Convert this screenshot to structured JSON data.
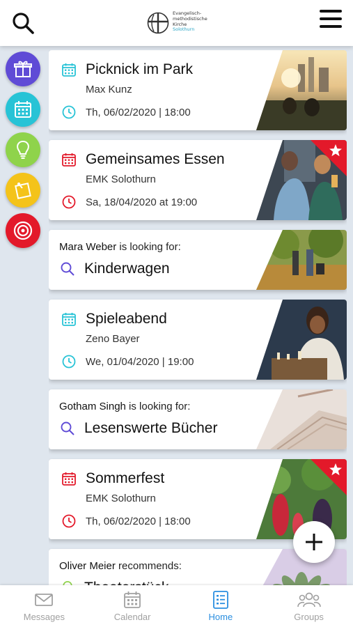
{
  "header": {
    "logo_lines": [
      "Evangelisch-",
      "methodistische",
      "Kirche"
    ],
    "logo_city": "Solothurn"
  },
  "rail": [
    {
      "name": "gift-icon",
      "color": "#5f4bd6"
    },
    {
      "name": "calendar-icon",
      "color": "#27c3d6"
    },
    {
      "name": "lightbulb-icon",
      "color": "#8fd34b"
    },
    {
      "name": "note-icon",
      "color": "#f4c31a"
    },
    {
      "name": "target-icon",
      "color": "#e3192a"
    }
  ],
  "feed": [
    {
      "type": "event",
      "title": "Picknick im Park",
      "subtitle": "Max Kunz",
      "date": "Th, 06/02/2020 | 18:00",
      "accent": "#27c3d6",
      "starred": false
    },
    {
      "type": "event",
      "title": "Gemeinsames Essen",
      "subtitle": "EMK Solothurn",
      "date": "Sa, 18/04/2020 at 19:00",
      "accent": "#e3192a",
      "starred": true
    },
    {
      "type": "looking",
      "person": "Mara Weber",
      "suffix": " is looking for:",
      "item": "Kinderwagen"
    },
    {
      "type": "event",
      "title": "Spieleabend",
      "subtitle": "Zeno Bayer",
      "date": "We, 01/04/2020 | 19:00",
      "accent": "#27c3d6",
      "starred": false
    },
    {
      "type": "looking",
      "person": "Gotham Singh",
      "suffix": " is looking for:",
      "item": "Lesenswerte Bücher"
    },
    {
      "type": "event",
      "title": "Sommerfest",
      "subtitle": "EMK Solothurn",
      "date": "Th, 06/02/2020 | 18:00",
      "accent": "#e3192a",
      "starred": true
    },
    {
      "type": "recommend",
      "person": "Oliver Meier",
      "suffix": " recommends:",
      "item": "Theaterstück"
    }
  ],
  "bottom_nav": [
    {
      "label": "Messages",
      "icon": "envelope-icon",
      "active": false
    },
    {
      "label": "Calendar",
      "icon": "calendar-icon",
      "active": false
    },
    {
      "label": "Home",
      "icon": "list-icon",
      "active": true
    },
    {
      "label": "Groups",
      "icon": "group-icon",
      "active": false
    }
  ],
  "colors": {
    "active": "#2a8ee0",
    "inactive": "#a0a0a0",
    "looking_icon": "#5f4bd6",
    "recommend_icon": "#8fd34b"
  }
}
